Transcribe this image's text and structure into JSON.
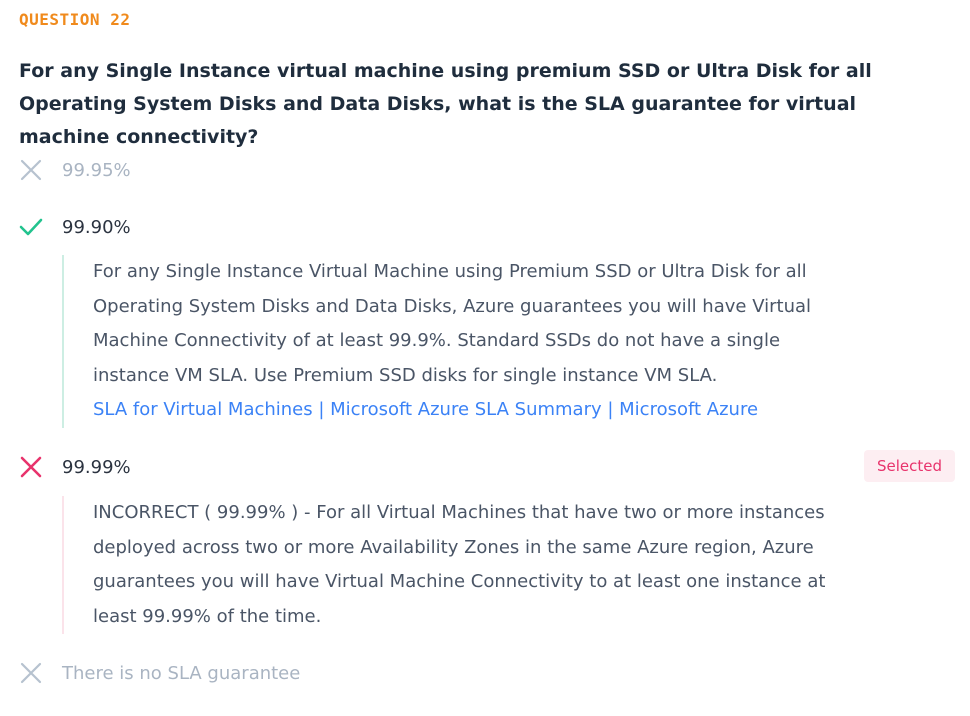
{
  "question": {
    "number_label": "QUESTION 22",
    "text": "For any Single Instance virtual machine using premium SSD or Ultra Disk for all Operating System Disks and Data Disks, what is the SLA guarantee for virtual machine connectivity?"
  },
  "options": [
    {
      "label": "99.95%",
      "state": "unselected-incorrect",
      "icon": "x-icon",
      "icon_color": "#b6c2cf"
    },
    {
      "label": "99.90%",
      "state": "correct",
      "icon": "check-icon",
      "icon_color": "#22c38e",
      "explanation": "For any Single Instance Virtual Machine using Premium SSD or Ultra Disk for all Operating System Disks and Data Disks, Azure guarantees you will have Virtual Machine Connectivity of at least 99.9%. Standard SSDs do not have a single instance VM SLA. Use Premium SSD disks for single instance VM SLA.",
      "link_text": "SLA for Virtual Machines | Microsoft Azure SLA Summary | Microsoft Azure"
    },
    {
      "label": "99.99%",
      "state": "selected-incorrect",
      "icon": "x-icon",
      "icon_color": "#e8336c",
      "badge": "Selected",
      "explanation": "INCORRECT ( 99.99% ) - For all Virtual Machines that have two or more instances deployed across two or more Availability Zones in the same Azure region, Azure guarantees you will have Virtual Machine Connectivity to at least one instance at least 99.99% of the time."
    },
    {
      "label": "There is no SLA guarantee",
      "state": "unselected-incorrect",
      "icon": "x-icon",
      "icon_color": "#b6c2cf"
    }
  ],
  "colors": {
    "question_number": "#f08a1c",
    "link": "#3b82f6",
    "correct": "#22c38e",
    "incorrect": "#e8336c",
    "muted": "#a9b4c2"
  }
}
